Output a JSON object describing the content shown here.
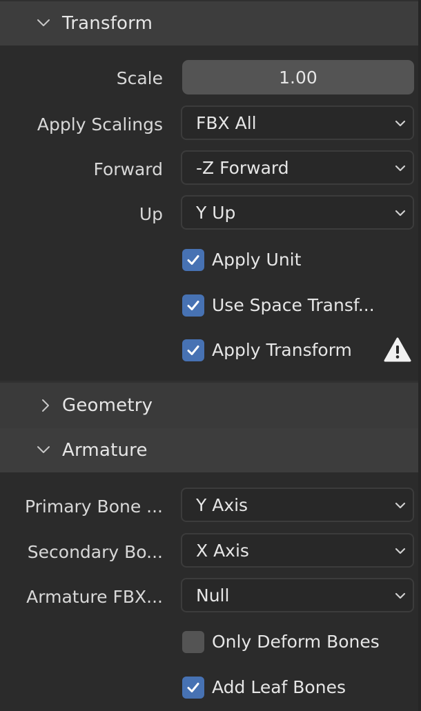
{
  "colors": {
    "header_bg": "#3d3d3d",
    "panel_bg": "#2b2b2b",
    "checkbox_on": "#4772b3",
    "checkbox_off": "#545454",
    "numfield_bg": "#545454",
    "dropdown_bg": "#282828"
  },
  "transform": {
    "title": "Transform",
    "expanded": true,
    "chevron_icon": "chevron-down-icon",
    "scale": {
      "label": "Scale",
      "value": "1.00"
    },
    "apply_scalings": {
      "label": "Apply Scalings",
      "value": "FBX All"
    },
    "forward": {
      "label": "Forward",
      "value": "-Z Forward"
    },
    "up": {
      "label": "Up",
      "value": "Y Up"
    },
    "apply_unit": {
      "label": "Apply Unit",
      "checked": true
    },
    "use_space_transform": {
      "label": "Use Space Transf...",
      "checked": true
    },
    "apply_transform": {
      "label": "Apply Transform",
      "checked": true,
      "warning_icon": "warning-icon"
    }
  },
  "geometry": {
    "title": "Geometry",
    "expanded": false,
    "chevron_icon": "chevron-right-icon"
  },
  "armature": {
    "title": "Armature",
    "expanded": true,
    "chevron_icon": "chevron-down-icon",
    "primary_bone_axis": {
      "label": "Primary Bone ...",
      "value": "Y Axis"
    },
    "secondary_bone_axis": {
      "label": "Secondary Bo...",
      "value": "X Axis"
    },
    "armature_fbx_node_type": {
      "label": "Armature FBX...",
      "value": "Null"
    },
    "only_deform_bones": {
      "label": "Only Deform Bones",
      "checked": false
    },
    "add_leaf_bones": {
      "label": "Add Leaf Bones",
      "checked": true
    }
  }
}
